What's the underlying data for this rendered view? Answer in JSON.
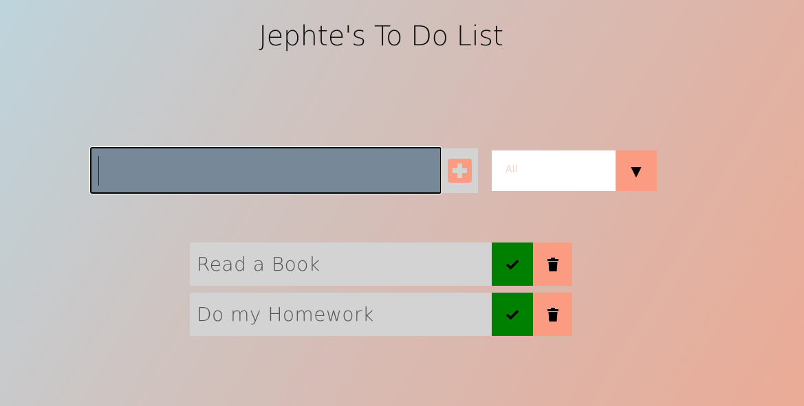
{
  "app": {
    "title": "Jephte's To Do List"
  },
  "input": {
    "value": "",
    "placeholder": "",
    "add_icon": "plus-icon"
  },
  "filter": {
    "selected": "All",
    "arrow": "▼"
  },
  "todos": [
    {
      "text": "Read a Book",
      "complete_icon": "check-icon",
      "delete_icon": "trash-icon"
    },
    {
      "text": "Do my Homework",
      "complete_icon": "check-icon",
      "delete_icon": "trash-icon"
    }
  ],
  "colors": {
    "accent": "#fa9b82",
    "complete": "#008000",
    "input_bg": "#778899",
    "item_bg": "#d3d3d3"
  }
}
